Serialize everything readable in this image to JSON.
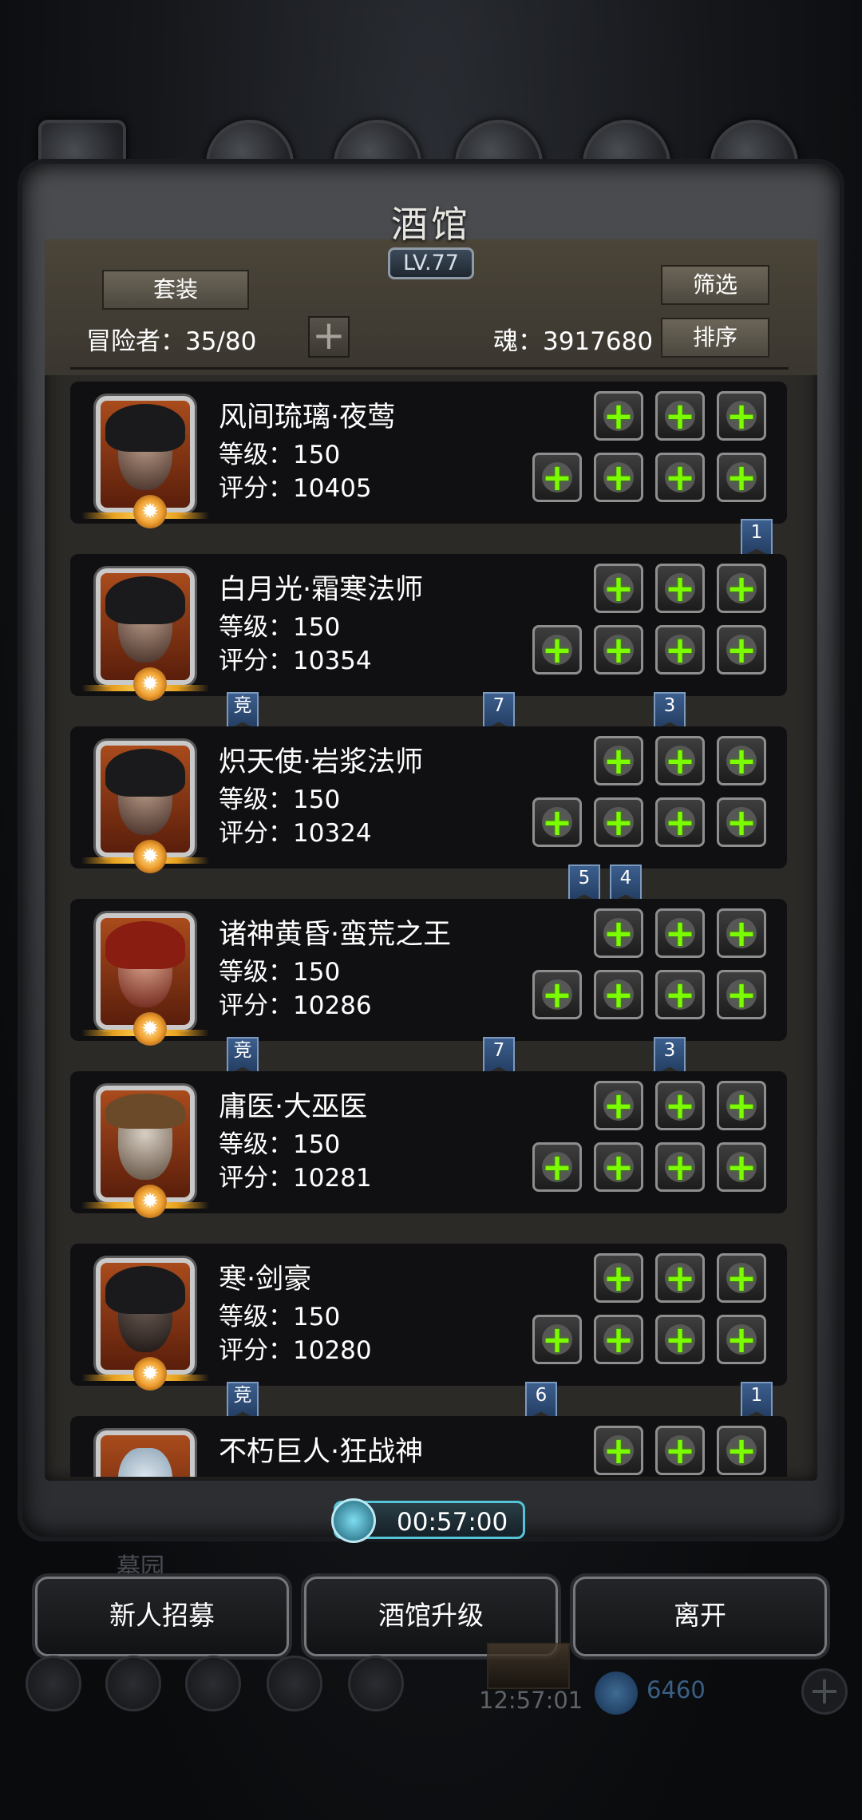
{
  "window": {
    "title": "酒馆",
    "level_badge": "LV.77"
  },
  "header": {
    "set_button": "套装",
    "filter_button": "筛选",
    "sort_button": "排序",
    "adventurers_label": "冒险者：35/80",
    "soul_label": "魂：3917680"
  },
  "heroes": [
    {
      "name": "风间琉璃·夜莺",
      "level": "等级：150",
      "score": "评分：10405"
    },
    {
      "name": "白月光·霜寒法师",
      "level": "等级：150",
      "score": "评分：10354"
    },
    {
      "name": "炽天使·岩浆法师",
      "level": "等级：150",
      "score": "评分：10324"
    },
    {
      "name": "诸神黄昏·蛮荒之王",
      "level": "等级：150",
      "score": "评分：10286"
    },
    {
      "name": "庸医·大巫医",
      "level": "等级：150",
      "score": "评分：10281"
    },
    {
      "name": "寒·剑豪",
      "level": "等级：150",
      "score": "评分：10280"
    },
    {
      "name": "不朽巨人·狂战神",
      "level": "",
      "score": ""
    }
  ],
  "ribbons": {
    "r1": "1",
    "r2a": "竞",
    "r2b": "7",
    "r2c": "3",
    "r3a": "5",
    "r3b": "4",
    "r4a": "竞",
    "r4b": "7",
    "r4c": "3",
    "r6a": "竞",
    "r6b": "6",
    "r6c": "1"
  },
  "timer": "00:57:00",
  "background_label": "墓园",
  "footer": {
    "recruit_button": "新人招募",
    "upgrade_button": "酒馆升级",
    "leave_button": "离开"
  },
  "background_status": {
    "time": "12:57:01",
    "crystals": "6460"
  },
  "colors": {
    "plus_green": "#7cfc00",
    "ribbon_blue": "#2f4f7a",
    "timer_cyan": "#56c4d8"
  }
}
